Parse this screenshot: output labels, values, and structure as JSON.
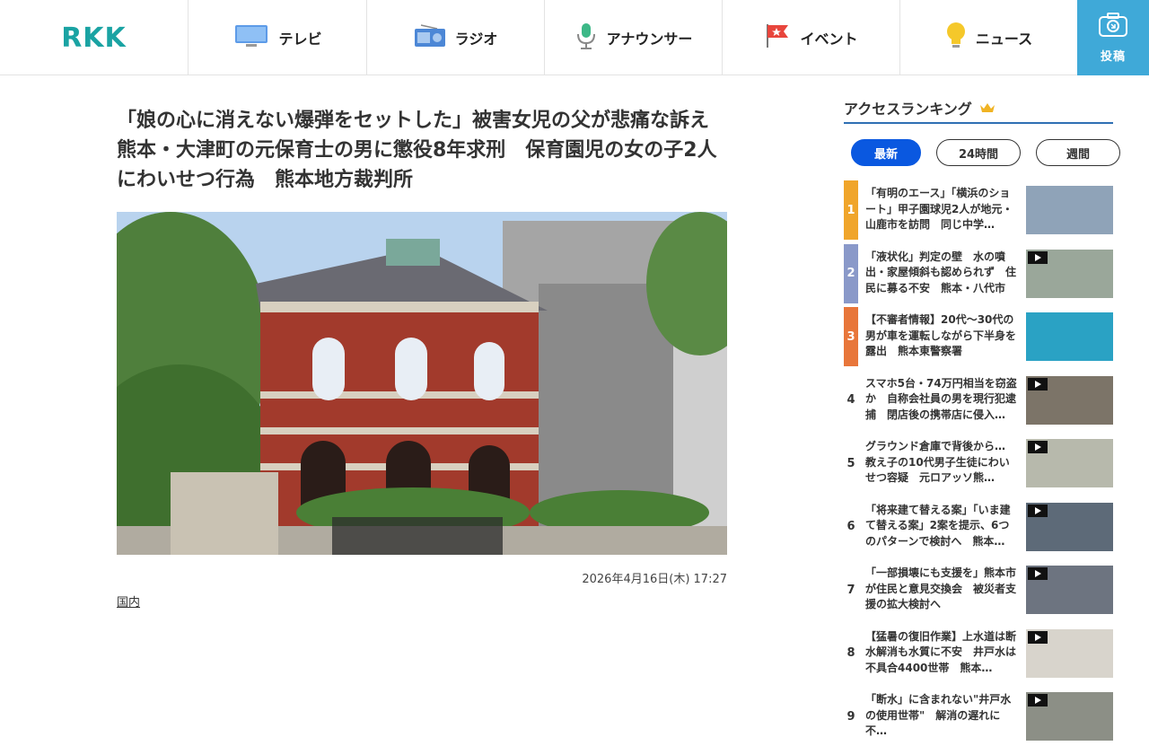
{
  "header": {
    "logo": "RKK",
    "nav": [
      {
        "label": "テレビ",
        "icon": "tv-icon"
      },
      {
        "label": "ラジオ",
        "icon": "radio-icon"
      },
      {
        "label": "アナウンサー",
        "icon": "microphone-icon"
      },
      {
        "label": "イベント",
        "icon": "flag-icon"
      },
      {
        "label": "ニュース",
        "icon": "lightbulb-icon"
      }
    ],
    "post_label": "投稿",
    "post_icon": "camera-icon"
  },
  "article": {
    "title": "「娘の心に消えない爆弾をセットした」被害女児の父が悲痛な訴え　熊本・大津町の元保育士の男に懲役8年求刑　保育園児の女の子2人にわいせつ行為　熊本地方裁判所",
    "date": "2026年4月16日(木) 17:27",
    "category": "国内"
  },
  "ranking": {
    "title": "アクセスランキング",
    "tabs": [
      "最新",
      "24時間",
      "週間"
    ],
    "items": [
      {
        "rank": "1",
        "text": "「有明のエース」「横浜のショート」甲子園球児2人が地元・山鹿市を訪問　同じ中学…",
        "color": "#f0a52b",
        "thumb": "#8fa3b8"
      },
      {
        "rank": "2",
        "text": "「液状化」判定の壁　水の噴出・家屋傾斜も認められず　住民に募る不安　熊本・八代市",
        "color": "#8a99c9",
        "thumb": "#9aa79a"
      },
      {
        "rank": "3",
        "text": "【不審者情報】20代～30代の男が車を運転しながら下半身を露出　熊本東警察署",
        "color": "#e8763a",
        "thumb": "#2aa2c4"
      },
      {
        "rank": "4",
        "text": "スマホ5台・74万円相当を窃盗か　自称会社員の男を現行犯逮捕　閉店後の携帯店に侵入…",
        "color": "#ffffff",
        "thumb": "#7c7468"
      },
      {
        "rank": "5",
        "text": "グラウンド倉庫で背後から…　教え子の10代男子生徒にわいせつ容疑　元ロアッソ熊…",
        "color": "#ffffff",
        "thumb": "#b7b9ac"
      },
      {
        "rank": "6",
        "text": "「将来建て替える案」「いま建て替える案」2案を提示、6つのパターンで検討へ　熊本…",
        "color": "#ffffff",
        "thumb": "#5d6a78"
      },
      {
        "rank": "7",
        "text": "「一部損壊にも支援を」熊本市が住民と意見交換会　被災者支援の拡大検討へ",
        "color": "#ffffff",
        "thumb": "#6d7480"
      },
      {
        "rank": "8",
        "text": "【猛暑の復旧作業】上水道は断水解消も水質に不安　井戸水は不具合4400世帯　熊本…",
        "color": "#ffffff",
        "thumb": "#d8d4cc"
      },
      {
        "rank": "9",
        "text": "「断水」に含まれない\"井戸水の使用世帯\"　解消の遅れに不…",
        "color": "#ffffff",
        "thumb": "#8c8f86"
      }
    ]
  },
  "colors": {
    "brand": "#1aa3a3",
    "post_bg": "#3fa9d8",
    "tab_active": "#0a58e0",
    "rank_underline": "#2f6fb3"
  }
}
